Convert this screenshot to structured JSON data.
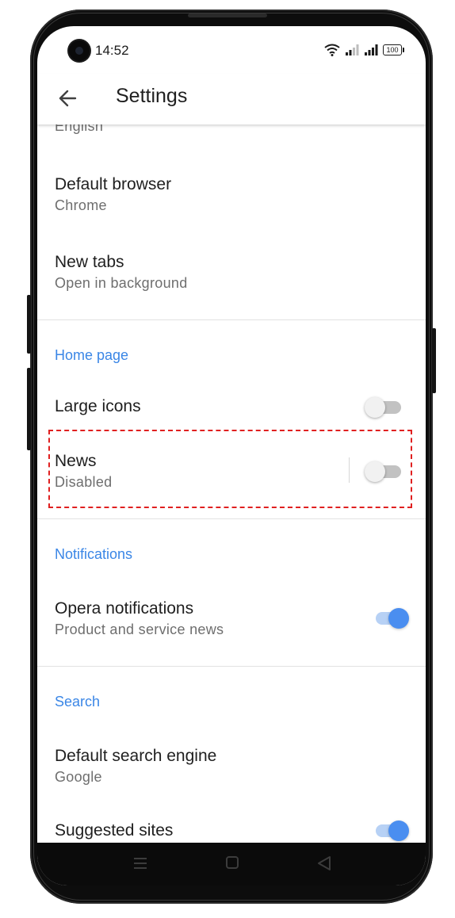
{
  "status_bar": {
    "time": "14:52",
    "battery": "100"
  },
  "header": {
    "title": "Settings"
  },
  "settings": {
    "language_value": "English",
    "default_browser": {
      "label": "Default browser",
      "value": "Chrome"
    },
    "new_tabs": {
      "label": "New tabs",
      "value": "Open in background"
    },
    "home_page_section": "Home page",
    "large_icons": {
      "label": "Large icons",
      "enabled": false
    },
    "news": {
      "label": "News",
      "value": "Disabled",
      "enabled": false
    },
    "notifications_section": "Notifications",
    "opera_notifications": {
      "label": "Opera notifications",
      "value": "Product and service news",
      "enabled": true
    },
    "search_section": "Search",
    "default_search_engine": {
      "label": "Default search engine",
      "value": "Google"
    },
    "suggested_sites": {
      "label": "Suggested sites",
      "enabled": true
    }
  },
  "colors": {
    "accent": "#3a86e6",
    "toggle_on": "#4a8ef0",
    "highlight": "#e02020"
  },
  "icons": [
    "back-arrow-icon",
    "wifi-icon",
    "signal-icon",
    "battery-icon",
    "recents-icon",
    "home-icon",
    "back-nav-icon"
  ]
}
